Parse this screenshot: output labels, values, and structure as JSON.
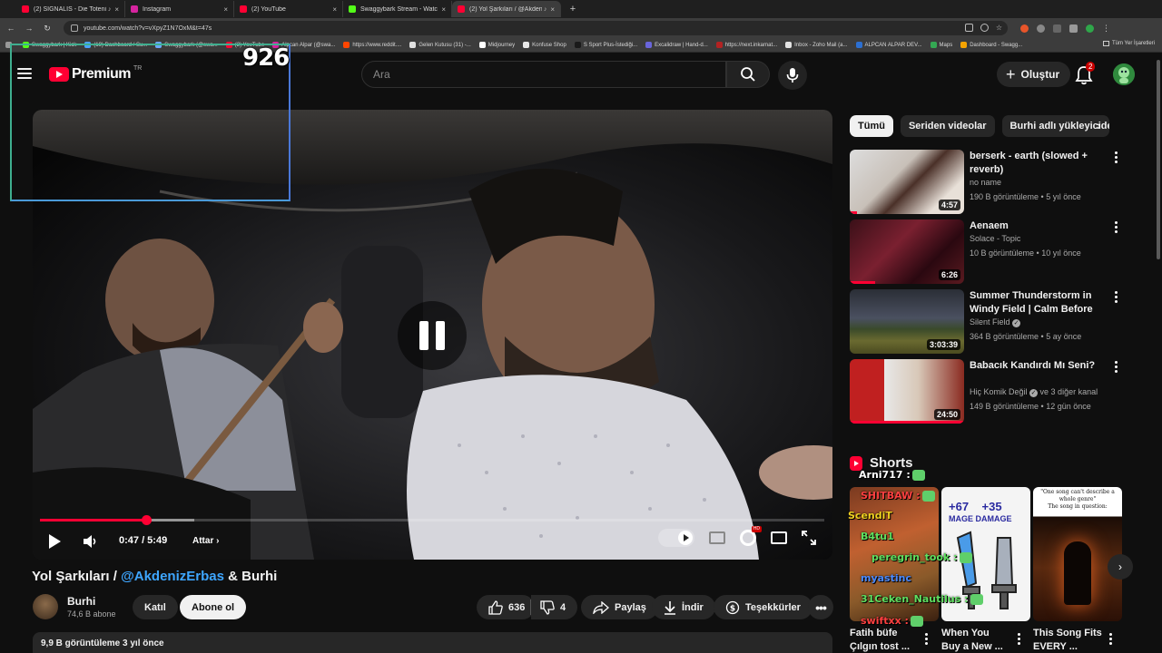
{
  "browser": {
    "tabs": [
      {
        "title": "(2) SIGNALIS - Die Totenin...",
        "color": "#ff0033",
        "audio": true,
        "active": false
      },
      {
        "title": "Instagram",
        "color": "#d6249f",
        "audio": false,
        "active": false
      },
      {
        "title": "(2) YouTube",
        "color": "#ff0033",
        "audio": false,
        "active": false
      },
      {
        "title": "Swaggybark Stream - Watch Li...",
        "color": "#53fc18",
        "audio": false,
        "active": false
      },
      {
        "title": "(2) Yol Şarkıları / @Akdeni...",
        "color": "#ff0033",
        "audio": true,
        "active": true
      }
    ],
    "url": "youtube.com/watch?v=vXpyZ1N7OxM&t=47s",
    "bookmarks": [
      {
        "label": "Swaggybark | Kick",
        "color": "#53fc18"
      },
      {
        "label": "(19) Dashboard / Su...",
        "color": "#4aa3ff"
      },
      {
        "label": "Swaggybark (@swa...",
        "color": "#6aa9ff"
      },
      {
        "label": "(2) YouTube",
        "color": "#ff0033"
      },
      {
        "label": "Alpcan Alpar (@swa...",
        "color": "#d6249f"
      },
      {
        "label": "https://www.reddit....",
        "color": "#ff4500"
      },
      {
        "label": "Gelen Kutusu (31) -...",
        "color": "#e0e0e0"
      },
      {
        "label": "Midjourney",
        "color": "#ffffff"
      },
      {
        "label": "Konfuse Shop",
        "color": "#e8e8e8"
      },
      {
        "label": "S Sport Plus-İstediği...",
        "color": "#1a1a1a"
      },
      {
        "label": "Excalidraw | Hand-d...",
        "color": "#6965db"
      },
      {
        "label": "https://next.inkarnat...",
        "color": "#b22222"
      },
      {
        "label": "Inbox - Zoho Mail (a...",
        "color": "#e2e2e2"
      },
      {
        "label": "ALPCAN ALPAR DEV...",
        "color": "#2c6fd1"
      },
      {
        "label": "Maps",
        "color": "#34a853"
      },
      {
        "label": "Dashboard - Swagg...",
        "color": "#f4a300"
      }
    ],
    "bookmarks_all": "Tüm Yer İşaretleri"
  },
  "masthead": {
    "logo_word": "Premium",
    "country": "TR",
    "search_placeholder": "Ara",
    "create_label": "Oluştur",
    "notif_count": "2"
  },
  "overlay": {
    "counter": "926"
  },
  "player": {
    "time": "0:47 / 5:49",
    "share_label": "Attar",
    "progress": 0.135,
    "buffered": 0.197
  },
  "video": {
    "title_prefix": "Yol Şarkıları / ",
    "title_link": "@AkdenizErbas",
    "title_suffix": " & Burhi",
    "channel": "Burhi",
    "subs": "74,6 B abone",
    "join": "Katıl",
    "subscribe": "Abone ol",
    "likes": "636",
    "dislikes": "4",
    "share": "Paylaş",
    "download": "İndir",
    "thanks": "Teşekkürler",
    "meta": "9,9 B görüntüleme  3 yıl önce"
  },
  "sidebar": {
    "chips": [
      "Tümü",
      "Seriden videolar",
      "Burhi adlı yükleyiciden"
    ],
    "recs": [
      {
        "title": "berserk - earth (slowed + reverb)",
        "channel": "no name",
        "meta": "190 B görüntüleme • 5 yıl önce",
        "duration": "4:57",
        "verified": false,
        "watched": 0.06
      },
      {
        "title": "Aenaem",
        "channel": "Solace - Topic",
        "meta": "10 B görüntüleme • 10 yıl önce",
        "duration": "6:26",
        "verified": false,
        "watched": 0.22
      },
      {
        "title": "Summer Thunderstorm in Windy Field | Calm Before the ...",
        "channel": "Silent Field",
        "meta": "364 B görüntüleme • 5 ay önce",
        "duration": "3:03:39",
        "verified": true,
        "watched": 0
      },
      {
        "title": "Babacık Kandırdı Mı Seni?",
        "channel": "Hiç Komik Değil",
        "channel_extra": "ve 3 diğer kanal",
        "meta": "149 B görüntüleme • 12 gün önce",
        "duration": "24:50",
        "verified": true,
        "watched": 1.0
      }
    ],
    "shorts_label": "Shorts",
    "shorts": [
      {
        "title": "Fatih büfe Çılgın tost ..."
      },
      {
        "title": "When You Buy a New ...",
        "thumb_top": "+67    +35",
        "thumb_sub": "MAGE DAMAGE"
      },
      {
        "title": "This Song Fits EVERY ...",
        "thumb_top": "\"One song can't describe a whole genre\"",
        "thumb_sub": "The song in question:"
      }
    ]
  },
  "chat": [
    {
      "user": "Arni717 :",
      "color": "#ffffff"
    },
    {
      "user": "SHITBAW :",
      "color": "#ff4040"
    },
    {
      "user": "ScendiT",
      "color": "#f0d020"
    },
    {
      "user": "B4tu1",
      "color": "#5fe060"
    },
    {
      "user": "peregrin_took :",
      "color": "#5fe060"
    },
    {
      "user": "myastinc",
      "color": "#4a8aff"
    },
    {
      "user": "31Ceken_Nautilus :",
      "color": "#5fe060"
    },
    {
      "user": "swiftxx :",
      "color": "#ff4040"
    }
  ]
}
